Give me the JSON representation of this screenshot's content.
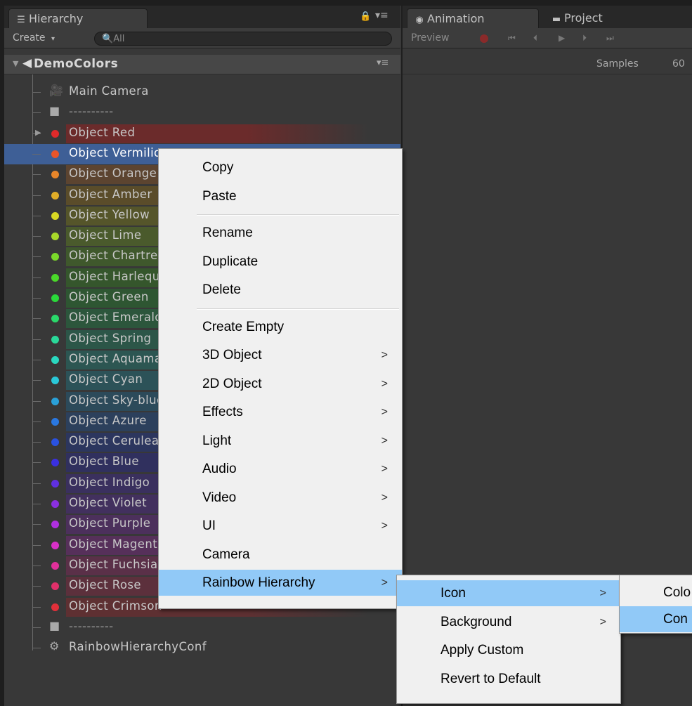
{
  "hierarchy": {
    "tab_label": "Hierarchy",
    "create_label": "Create",
    "search_placeholder": "All",
    "scene_name": "DemoColors",
    "items": [
      {
        "label": "Main Camera",
        "kind": "camera"
      },
      {
        "label": "----------",
        "kind": "separator"
      },
      {
        "label": "Object Red",
        "color": "#e02a2a",
        "band": "#6b2b2b"
      },
      {
        "label": "Object Vermilion",
        "color": "#e8552a",
        "band": "#3e5f96"
      },
      {
        "label": "Object Orange",
        "color": "#e8862a",
        "band": "#5c4430"
      },
      {
        "label": "Object Amber",
        "color": "#e0ad28",
        "band": "#5a4c2a"
      },
      {
        "label": "Object Yellow",
        "color": "#d8d824",
        "band": "#55552a"
      },
      {
        "label": "Object Lime",
        "color": "#a8d82a",
        "band": "#4a5a2c"
      },
      {
        "label": "Object Chartreuse",
        "color": "#7ad82a",
        "band": "#3f582c"
      },
      {
        "label": "Object Harlequin",
        "color": "#4ad82a",
        "band": "#35562c"
      },
      {
        "label": "Object Green",
        "color": "#2ad83a",
        "band": "#2e5632"
      },
      {
        "label": "Object Emerald",
        "color": "#2ad86a",
        "band": "#2c563c"
      },
      {
        "label": "Object Spring",
        "color": "#2ad89a",
        "band": "#2c5648"
      },
      {
        "label": "Object Aquamarine",
        "color": "#2ad8c0",
        "band": "#2c5652"
      },
      {
        "label": "Object Cyan",
        "color": "#2ac8d8",
        "band": "#2c5258"
      },
      {
        "label": "Object Sky-blue",
        "color": "#2aa0d8",
        "band": "#2c4a5a"
      },
      {
        "label": "Object Azure",
        "color": "#2a78e0",
        "band": "#2c405c"
      },
      {
        "label": "Object Cerulean",
        "color": "#2a52e0",
        "band": "#2c365e"
      },
      {
        "label": "Object Blue",
        "color": "#3a30e0",
        "band": "#30305e"
      },
      {
        "label": "Object Indigo",
        "color": "#6030e0",
        "band": "#3a305e"
      },
      {
        "label": "Object Violet",
        "color": "#8a30e0",
        "band": "#42305e"
      },
      {
        "label": "Object Purple",
        "color": "#b030e0",
        "band": "#4c305c"
      },
      {
        "label": "Object Magenta",
        "color": "#d830c8",
        "band": "#56305a"
      },
      {
        "label": "Object Fuchsia",
        "color": "#e0309a",
        "band": "#5a3048"
      },
      {
        "label": "Object Rose",
        "color": "#e0306a",
        "band": "#5c303c"
      },
      {
        "label": "Object Crimson",
        "color": "#e0303a",
        "band": "#5e3032"
      },
      {
        "label": "----------",
        "kind": "separator"
      },
      {
        "label": "RainbowHierarchyConf",
        "kind": "config"
      }
    ]
  },
  "animation": {
    "tab_label": "Animation",
    "project_tab_label": "Project",
    "preview_label": "Preview",
    "samples_label": "Samples",
    "samples_value": "60"
  },
  "context_menu": {
    "group1": [
      "Copy",
      "Paste"
    ],
    "group2": [
      "Rename",
      "Duplicate",
      "Delete"
    ],
    "group3": [
      {
        "label": "Create Empty",
        "submenu": false
      },
      {
        "label": "3D Object",
        "submenu": true
      },
      {
        "label": "2D Object",
        "submenu": true
      },
      {
        "label": "Effects",
        "submenu": true
      },
      {
        "label": "Light",
        "submenu": true
      },
      {
        "label": "Audio",
        "submenu": true
      },
      {
        "label": "Video",
        "submenu": true
      },
      {
        "label": "UI",
        "submenu": true
      },
      {
        "label": "Camera",
        "submenu": false
      },
      {
        "label": "Rainbow Hierarchy",
        "submenu": true,
        "highlighted": true
      }
    ],
    "arrow": ">"
  },
  "rainbow_submenu": {
    "items": [
      {
        "label": "Icon",
        "submenu": true,
        "highlighted": true
      },
      {
        "label": "Background",
        "submenu": true
      },
      {
        "label": "Apply Custom",
        "submenu": false
      },
      {
        "label": "Revert to Default",
        "submenu": false
      }
    ]
  },
  "icon_submenu": {
    "items": [
      {
        "label": "Colo",
        "highlighted": false
      },
      {
        "label": "Con",
        "highlighted": true
      }
    ]
  }
}
